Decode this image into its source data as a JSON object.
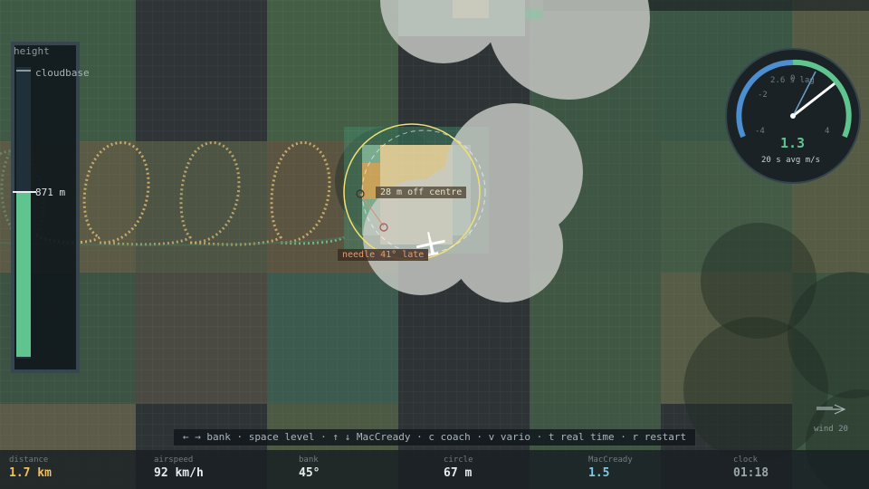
{
  "height_panel": {
    "title": "height",
    "cloudbase_label": "cloudbase",
    "value": "871 m",
    "fill_fraction": 0.53
  },
  "thermal": {
    "off_centre": "28 m off centre",
    "needle": "needle 41° late"
  },
  "vario": {
    "lag_label": "2.6 s lag",
    "value": "1.3",
    "avg_label": "20 s avg  m/s",
    "ticks": [
      "0",
      "-2",
      "-4",
      "2",
      "4"
    ]
  },
  "wind": {
    "label": "wind 20"
  },
  "keys": {
    "text": "← → bank · space level · ↑ ↓ MacCready · c coach · v vario · t real time · r restart"
  },
  "stats": [
    {
      "label": "distance",
      "value": "1.7 km",
      "color": "#f0c060"
    },
    {
      "label": "airspeed",
      "value": "92 km/h",
      "color": "#e6ecee"
    },
    {
      "label": "bank",
      "value": "45°",
      "color": "#e6ecee"
    },
    {
      "label": "circle",
      "value": "67 m",
      "color": "#e6ecee"
    },
    {
      "label": "MacCready",
      "value": "1.5",
      "color": "#7ec8e6"
    },
    {
      "label": "clock",
      "value": "01:18",
      "color": "#9aa6ab"
    }
  ]
}
